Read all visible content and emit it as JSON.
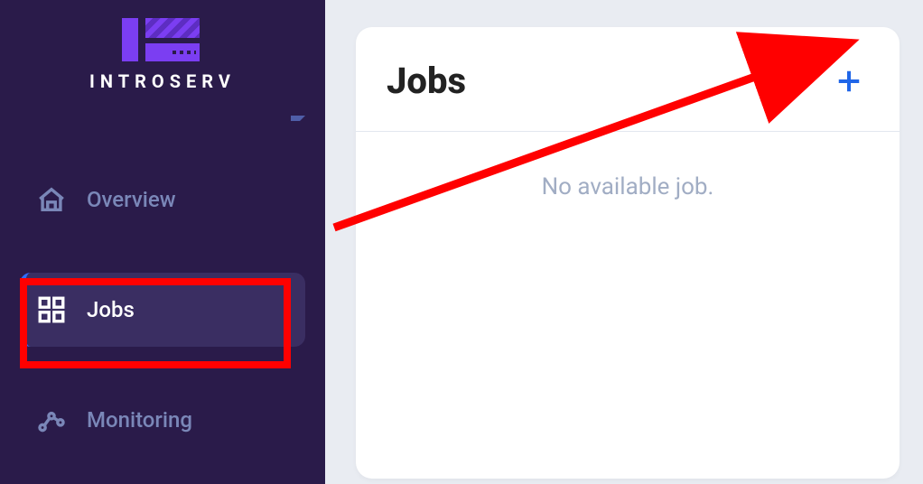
{
  "brand": {
    "name": "INTROSERV"
  },
  "sidebar": {
    "items": [
      {
        "label": "Overview"
      },
      {
        "label": "Jobs"
      },
      {
        "label": "Monitoring"
      }
    ]
  },
  "main": {
    "card_title": "Jobs",
    "empty_message": "No available job."
  },
  "colors": {
    "accent": "#2066e8",
    "sidebar_bg": "#2a1b4a",
    "highlight": "#ff0000"
  }
}
